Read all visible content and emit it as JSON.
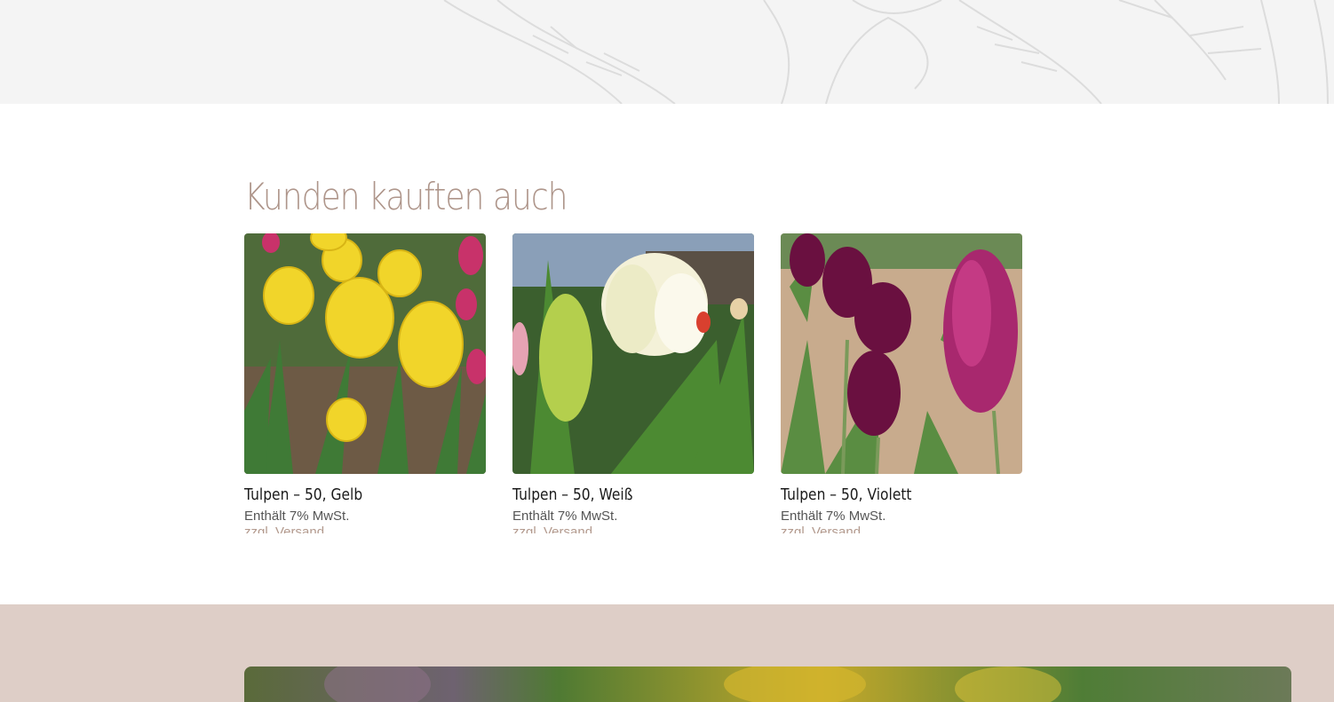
{
  "section": {
    "heading": "Kunden kauften auch"
  },
  "products": [
    {
      "title": "Tulpen – 50, Gelb",
      "tax_note": "Enthält 7% MwSt.",
      "shipping_note": "zzgl. Versand",
      "image": "yellow-fringed-tulips"
    },
    {
      "title": "Tulpen – 50, Weiß",
      "tax_note": "Enthält 7% MwSt.",
      "shipping_note": "zzgl. Versand",
      "image": "white-tulip-closeup"
    },
    {
      "title": "Tulpen – 50, Violett",
      "tax_note": "Enthält 7% MwSt.",
      "shipping_note": "zzgl. Versand",
      "image": "violet-tulips"
    }
  ],
  "colors": {
    "heading": "#ae958a",
    "top_band": "#f4f4f4",
    "bottom_band": "#decec7"
  }
}
